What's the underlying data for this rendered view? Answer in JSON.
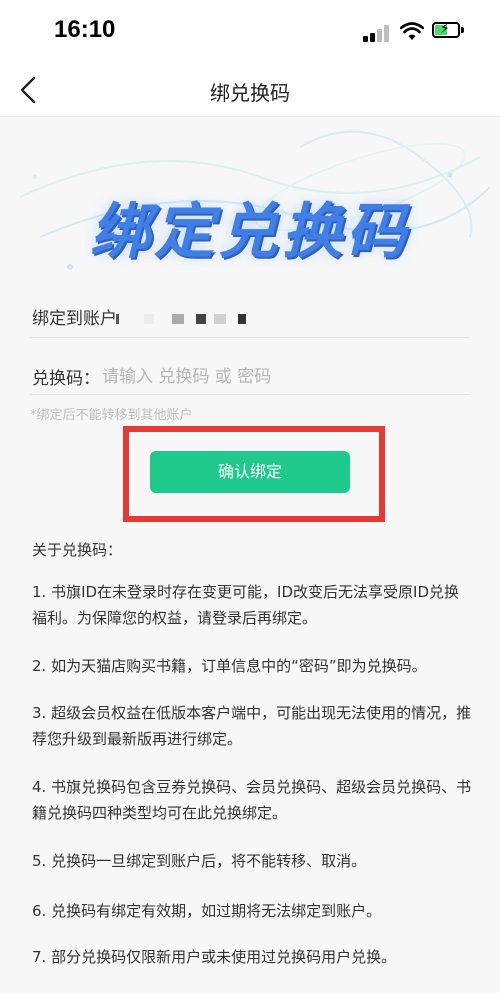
{
  "status_bar": {
    "time": "16:10"
  },
  "nav": {
    "title": "绑兑换码"
  },
  "banner": {
    "title": "绑定兑换码"
  },
  "form": {
    "account_label": "绑定到账户",
    "code_label": "兑换码：",
    "code_placeholder": "请输入 兑换码 或 密码",
    "note": "*绑定后不能转移到其他账户",
    "confirm_label": "确认绑定"
  },
  "about": {
    "title": "关于兑换码：",
    "items": [
      "1. 书旗ID在未登录时存在变更可能，ID改变后无法享受原ID兑换福利。为保障您的权益，请登录后再绑定。",
      "2. 如为天猫店购买书籍，订单信息中的“密码”即为兑换码。",
      "3. 超级会员权益在低版本客户端中，可能出现无法使用的情况，推荐您升级到最新版再进行绑定。",
      "4. 书旗兑换码包含豆券兑换码、会员兑换码、超级会员兑换码、书籍兑换码四种类型均可在此兑换绑定。",
      "5. 兑换码一旦绑定到账户后，将不能转移、取消。",
      "6. 兑换码有绑定有效期，如过期将无法绑定到账户。",
      "7. 部分兑换码仅限新用户或未使用过兑换码用户兑换。"
    ]
  },
  "colors": {
    "accent_green": "#1ec98b",
    "highlight_red": "#e53935",
    "banner_blue": "#3f7fe6"
  }
}
